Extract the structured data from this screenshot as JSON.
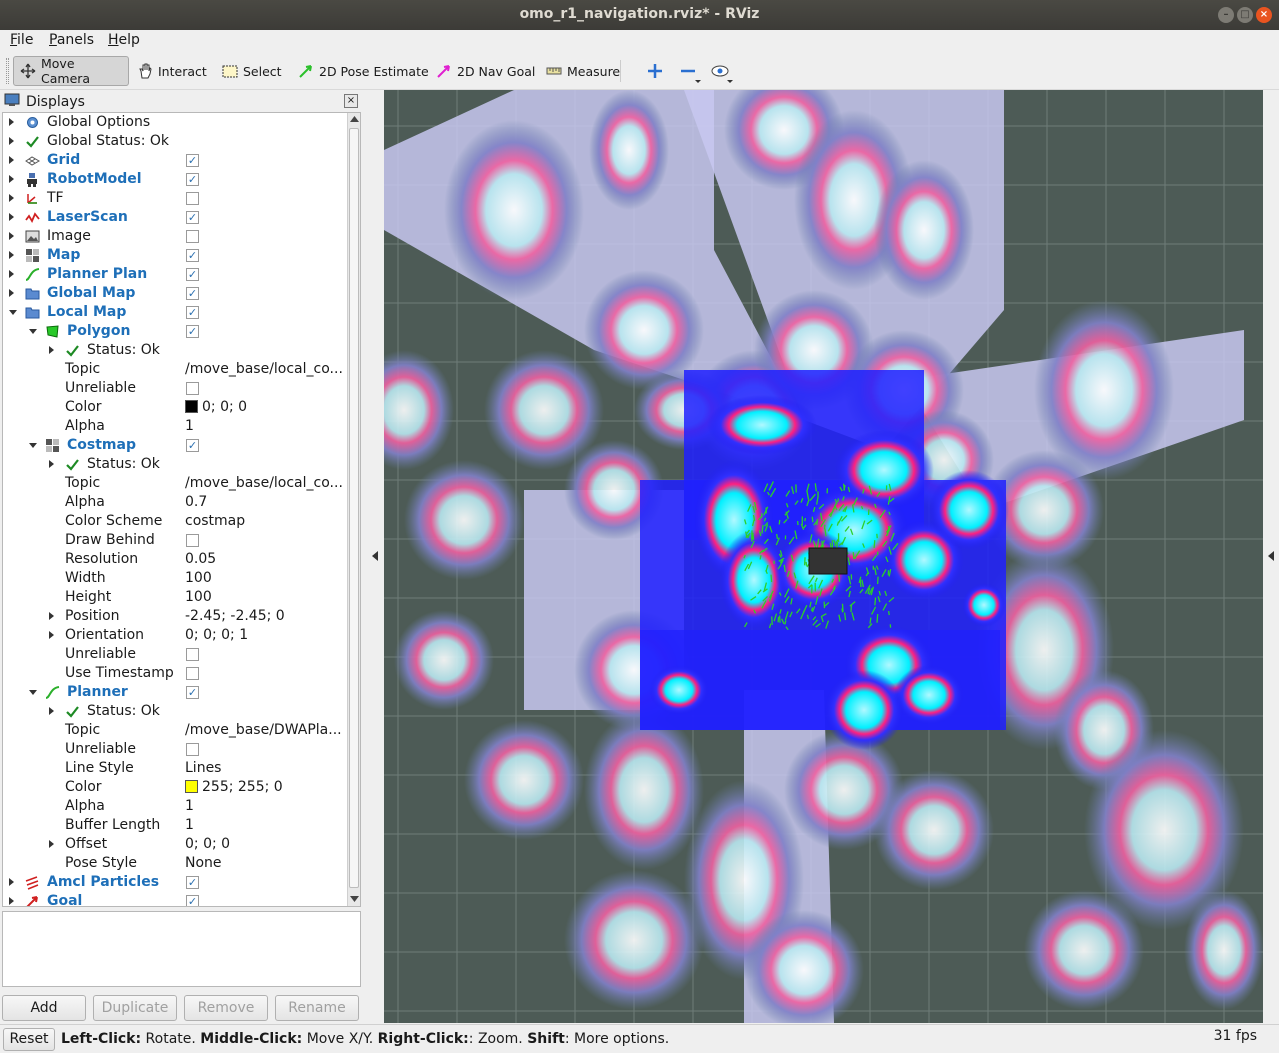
{
  "window": {
    "title": "omo_r1_navigation.rviz* - RViz"
  },
  "menu": {
    "items": [
      "File",
      "Panels",
      "Help"
    ]
  },
  "toolbar": {
    "tools": [
      {
        "label": "Move Camera",
        "icon": "move-camera-icon",
        "active": true
      },
      {
        "label": "Interact",
        "icon": "hand-icon"
      },
      {
        "label": "Select",
        "icon": "select-box-icon"
      },
      {
        "label": "2D Pose Estimate",
        "icon": "green-arrow-icon"
      },
      {
        "label": "2D Nav Goal",
        "icon": "magenta-arrow-icon"
      },
      {
        "label": "Measure",
        "icon": "ruler-icon"
      }
    ]
  },
  "displays": {
    "title": "Displays",
    "rows": [
      {
        "indent": 0,
        "arrow": "closed",
        "icon": "gear-icon",
        "label": "Global Options"
      },
      {
        "indent": 0,
        "arrow": "closed",
        "icon": "check-icon",
        "label": "Global Status: Ok"
      },
      {
        "indent": 0,
        "arrow": "closed",
        "icon": "grid-icon",
        "label": "Grid",
        "blue": true,
        "checked": true
      },
      {
        "indent": 0,
        "arrow": "closed",
        "icon": "robot-icon",
        "label": "RobotModel",
        "blue": true,
        "checked": true
      },
      {
        "indent": 0,
        "arrow": "closed",
        "icon": "tf-icon",
        "label": "TF",
        "checked": false
      },
      {
        "indent": 0,
        "arrow": "closed",
        "icon": "laser-icon",
        "label": "LaserScan",
        "blue": true,
        "checked": true
      },
      {
        "indent": 0,
        "arrow": "closed",
        "icon": "image-icon",
        "label": "Image",
        "checked": false
      },
      {
        "indent": 0,
        "arrow": "closed",
        "icon": "map-icon",
        "label": "Map",
        "blue": true,
        "checked": true
      },
      {
        "indent": 0,
        "arrow": "closed",
        "icon": "path-icon",
        "label": "Planner Plan",
        "blue": true,
        "checked": true
      },
      {
        "indent": 0,
        "arrow": "closed",
        "icon": "folder-icon",
        "label": "Global Map",
        "blue": true,
        "checked": true
      },
      {
        "indent": 0,
        "arrow": "open",
        "icon": "folder-icon",
        "label": "Local Map",
        "blue": true,
        "checked": true
      },
      {
        "indent": 1,
        "arrow": "open",
        "icon": "polygon-icon",
        "label": "Polygon",
        "blue": true,
        "checked": true
      },
      {
        "indent": 2,
        "arrow": "closed",
        "icon": "check-icon",
        "label": "Status: Ok"
      },
      {
        "indent": 2,
        "label": "Topic",
        "value": "/move_base/local_co..."
      },
      {
        "indent": 2,
        "label": "Unreliable",
        "checked": false
      },
      {
        "indent": 2,
        "label": "Color",
        "value": "0; 0; 0",
        "swatch": "#000000"
      },
      {
        "indent": 2,
        "label": "Alpha",
        "value": "1"
      },
      {
        "indent": 1,
        "arrow": "open",
        "icon": "map-icon",
        "label": "Costmap",
        "blue": true,
        "checked": true
      },
      {
        "indent": 2,
        "arrow": "closed",
        "icon": "check-icon",
        "label": "Status: Ok"
      },
      {
        "indent": 2,
        "label": "Topic",
        "value": "/move_base/local_co..."
      },
      {
        "indent": 2,
        "label": "Alpha",
        "value": "0.7"
      },
      {
        "indent": 2,
        "label": "Color Scheme",
        "value": "costmap"
      },
      {
        "indent": 2,
        "label": "Draw Behind",
        "checked": false
      },
      {
        "indent": 2,
        "label": "Resolution",
        "value": "0.05"
      },
      {
        "indent": 2,
        "label": "Width",
        "value": "100"
      },
      {
        "indent": 2,
        "label": "Height",
        "value": "100"
      },
      {
        "indent": 2,
        "arrow": "closed",
        "label": "Position",
        "value": "-2.45; -2.45; 0"
      },
      {
        "indent": 2,
        "arrow": "closed",
        "label": "Orientation",
        "value": "0; 0; 0; 1"
      },
      {
        "indent": 2,
        "label": "Unreliable",
        "checked": false
      },
      {
        "indent": 2,
        "label": "Use Timestamp",
        "checked": false
      },
      {
        "indent": 1,
        "arrow": "open",
        "icon": "path-icon",
        "label": "Planner",
        "blue": true,
        "checked": true
      },
      {
        "indent": 2,
        "arrow": "closed",
        "icon": "check-icon",
        "label": "Status: Ok"
      },
      {
        "indent": 2,
        "label": "Topic",
        "value": "/move_base/DWAPla..."
      },
      {
        "indent": 2,
        "label": "Unreliable",
        "checked": false
      },
      {
        "indent": 2,
        "label": "Line Style",
        "value": "Lines"
      },
      {
        "indent": 2,
        "label": "Color",
        "value": "255; 255; 0",
        "swatch": "#ffff00"
      },
      {
        "indent": 2,
        "label": "Alpha",
        "value": "1"
      },
      {
        "indent": 2,
        "label": "Buffer Length",
        "value": "1"
      },
      {
        "indent": 2,
        "arrow": "closed",
        "label": "Offset",
        "value": "0; 0; 0"
      },
      {
        "indent": 2,
        "label": "Pose Style",
        "value": "None"
      },
      {
        "indent": 0,
        "arrow": "closed",
        "icon": "particles-icon",
        "label": "Amcl Particles",
        "blue": true,
        "checked": true
      },
      {
        "indent": 0,
        "arrow": "closed",
        "icon": "goal-icon",
        "label": "Goal",
        "blue": true,
        "checked": true
      }
    ],
    "buttons": [
      {
        "label": "Add",
        "enabled": true
      },
      {
        "label": "Duplicate",
        "enabled": false
      },
      {
        "label": "Remove",
        "enabled": false
      },
      {
        "label": "Rename",
        "enabled": false
      }
    ]
  },
  "status": {
    "reset": "Reset",
    "hint_parts": [
      {
        "text": "Left-Click:",
        "bold": true
      },
      {
        "text": " Rotate. "
      },
      {
        "text": "Middle-Click:",
        "bold": true
      },
      {
        "text": " Move X/Y. "
      },
      {
        "text": "Right-Click:",
        "bold": true
      },
      {
        "text": ": Zoom. "
      },
      {
        "text": "Shift",
        "bold": true
      },
      {
        "text": ": More options."
      }
    ],
    "fps": "31 fps"
  },
  "colors": {
    "costmap_lethal": "#1a0a3a",
    "costmap_inscribed": "#00f0ff",
    "costmap_high": "#ff00ff",
    "costmap_low_blue": "#2020ff",
    "global_inflation": "#7090a0",
    "free_space": "#c8c8f0",
    "grid": "#6f7d78"
  }
}
